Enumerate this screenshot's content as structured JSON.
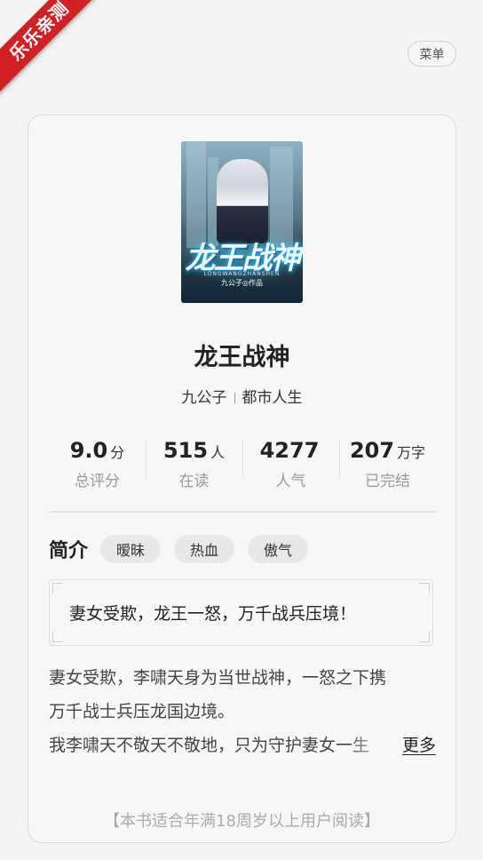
{
  "ribbon": {
    "text": "乐乐亲测"
  },
  "header": {
    "menu_label": "菜单"
  },
  "book": {
    "cover": {
      "title": "龙王战神",
      "subtitle": "LONGWANGZHANSHEN",
      "author_line": "九公子◎作品"
    },
    "title": "龙王战神",
    "author": "九公子",
    "category": "都市人生"
  },
  "stats": [
    {
      "value": "9.0",
      "unit": "分",
      "label": "总评分"
    },
    {
      "value": "515",
      "unit": "人",
      "label": "在读"
    },
    {
      "value": "4277",
      "unit": "",
      "label": "人气"
    },
    {
      "value": "207",
      "unit": "万字",
      "label": "已完结"
    }
  ],
  "intro": {
    "label": "简介",
    "tags": [
      "暧昧",
      "热血",
      "傲气"
    ],
    "tagline": "妻女受欺，龙王一怒，万千战兵压境！",
    "lines": [
      "妻女受欺，李啸天身为当世战神，一怒之下携",
      "万千战士兵压龙国边境。",
      "我李啸天不敬天不敬地，只为守护妻女一生"
    ],
    "more_label": "更多"
  },
  "notice": "【本书适合年满18周岁以上用户阅读】"
}
